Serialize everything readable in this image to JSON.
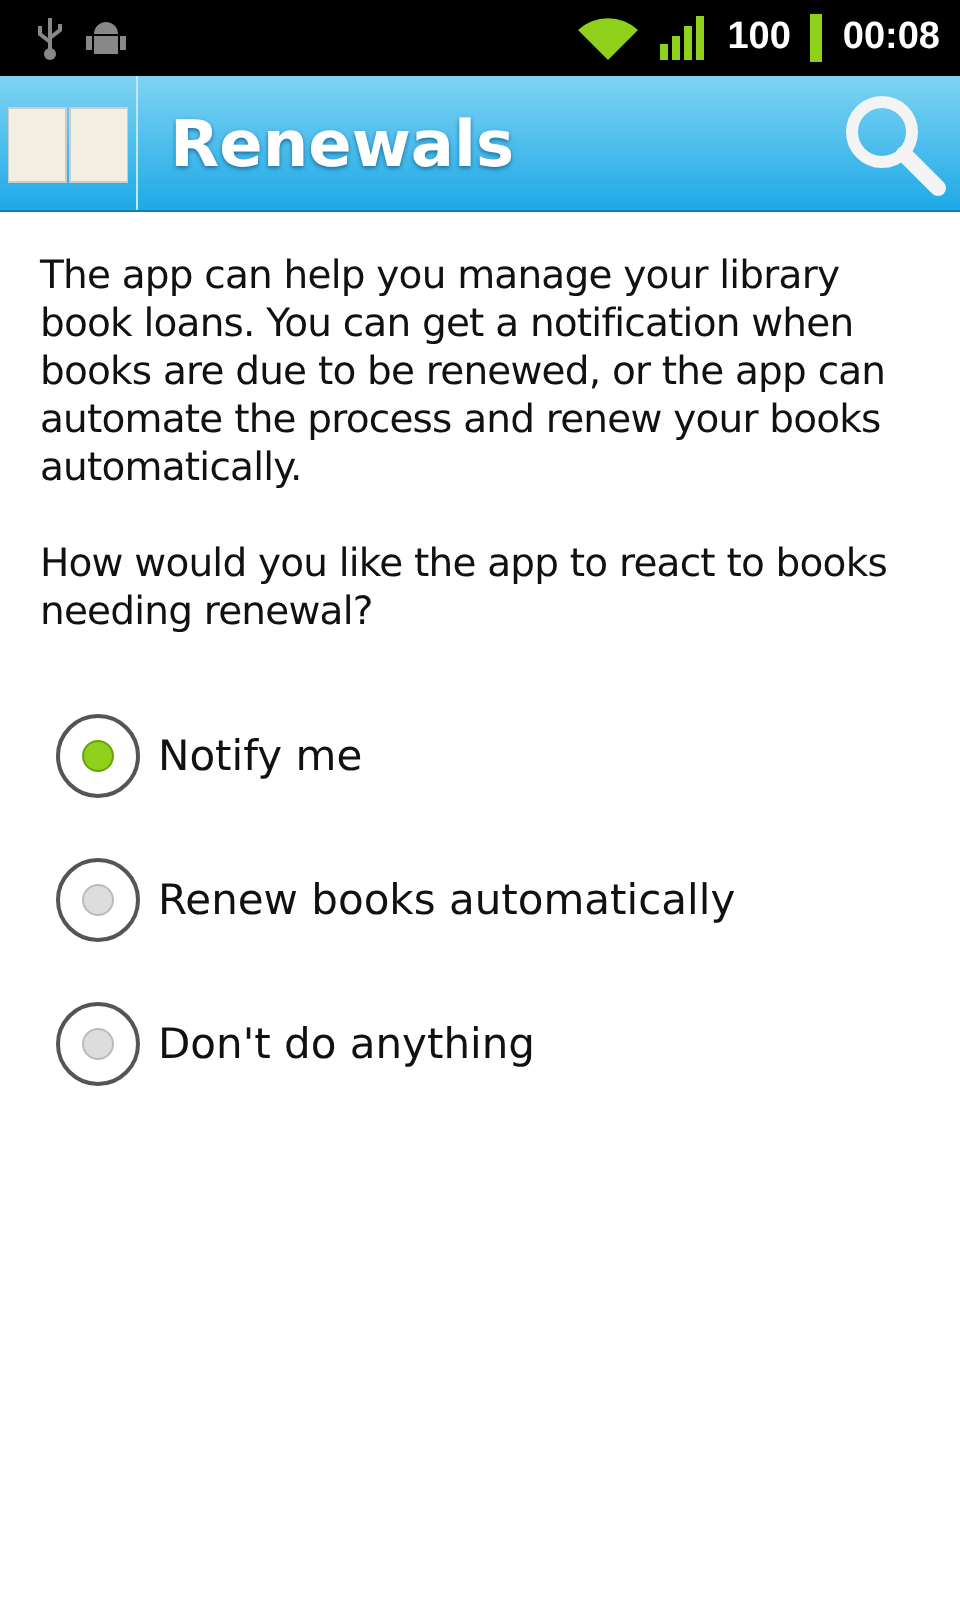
{
  "status_bar": {
    "battery": "100",
    "time": "00:08"
  },
  "action_bar": {
    "title": "Renewals"
  },
  "intro": "The app can help you manage your library book loans. You can get a notification when books are due to be renewed, or the app can automate the process and renew your books automatically.",
  "question": "How would you like the app to react to books needing renewal?",
  "options": [
    {
      "label": "Notify me",
      "selected": true
    },
    {
      "label": "Renew books automatically",
      "selected": false
    },
    {
      "label": "Don't do anything",
      "selected": false
    }
  ]
}
